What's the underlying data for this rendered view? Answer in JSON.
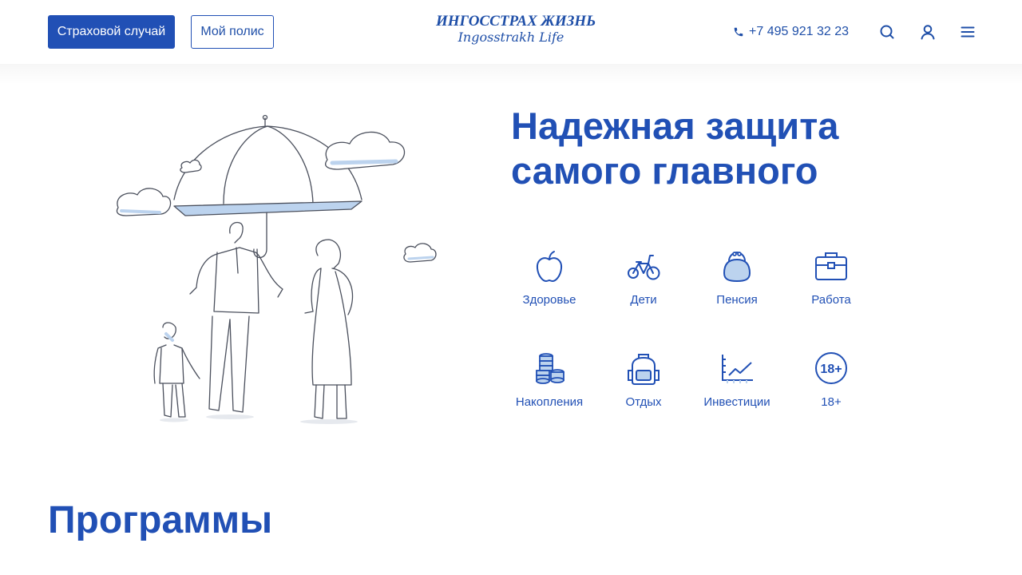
{
  "header": {
    "claim_button": "Страховой случай",
    "policy_button": "Мой полис",
    "logo": {
      "line1": "ИНГОССТРАХ ЖИЗНЬ",
      "line2": "Ingosstrakh Life"
    },
    "phone": "+7 495 921 32 23",
    "icons": [
      "phone-icon",
      "search-icon",
      "user-icon",
      "menu-icon"
    ]
  },
  "hero": {
    "title_line1": "Надежная защита",
    "title_line2": "самого главного"
  },
  "categories": [
    {
      "label": "Здоровье",
      "icon": "apple-icon"
    },
    {
      "label": "Дети",
      "icon": "bicycle-icon"
    },
    {
      "label": "Пенсия",
      "icon": "purse-icon"
    },
    {
      "label": "Работа",
      "icon": "briefcase-icon"
    },
    {
      "label": "Накопления",
      "icon": "coins-icon"
    },
    {
      "label": "Отдых",
      "icon": "backpack-icon"
    },
    {
      "label": "Инвестиции",
      "icon": "chart-icon"
    },
    {
      "label": "18+",
      "icon": "age-18-icon",
      "badge": "18+"
    }
  ],
  "sections": {
    "programs_title": "Программы"
  },
  "colors": {
    "brand": "#2150b5",
    "text": "#1f4fa8",
    "accent_light": "#bcd3ee"
  }
}
